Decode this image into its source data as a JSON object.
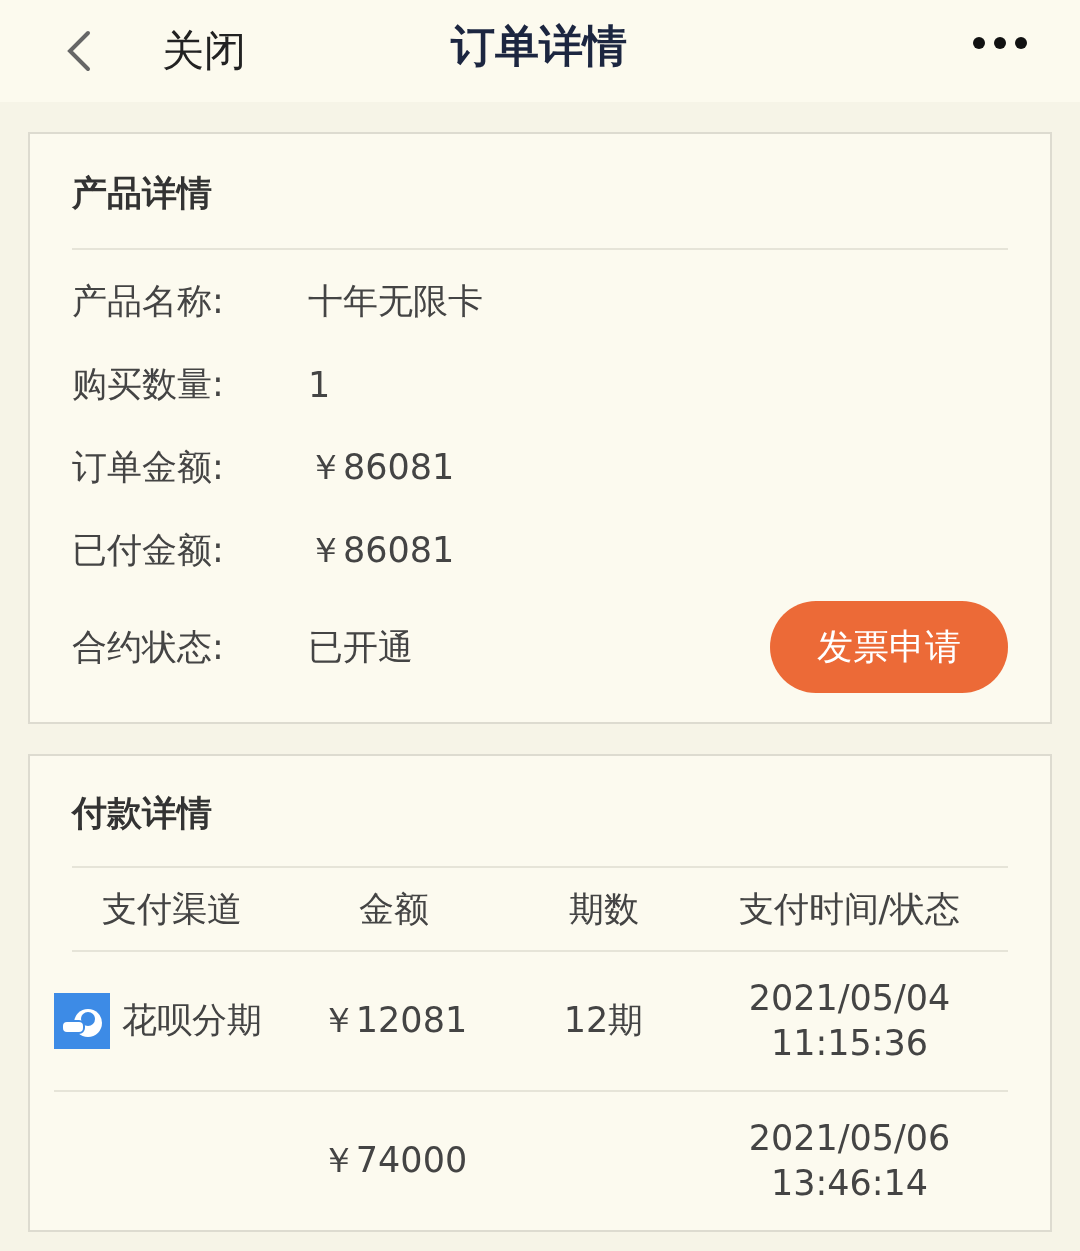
{
  "header": {
    "back_label": "关闭",
    "title": "订单详情"
  },
  "product": {
    "title": "产品详情",
    "rows": [
      {
        "label": "产品名称:",
        "value": "十年无限卡"
      },
      {
        "label": "购买数量:",
        "value": "1"
      },
      {
        "label": "订单金额:",
        "value": "￥86081"
      },
      {
        "label": "已付金额:",
        "value": "￥86081"
      },
      {
        "label": "合约状态:",
        "value": "已开通"
      }
    ],
    "button": "发票申请"
  },
  "payment": {
    "title": "付款详情",
    "columns": [
      "支付渠道",
      "金额",
      "期数",
      "支付时间/状态"
    ],
    "rows": [
      {
        "channel": "花呗分期",
        "amount": "￥12081",
        "periods": "12期",
        "date": "2021/05/04",
        "time": "11:15:36"
      },
      {
        "amount": "￥74000",
        "date": "2021/05/06",
        "time": "13:46:14"
      }
    ]
  }
}
